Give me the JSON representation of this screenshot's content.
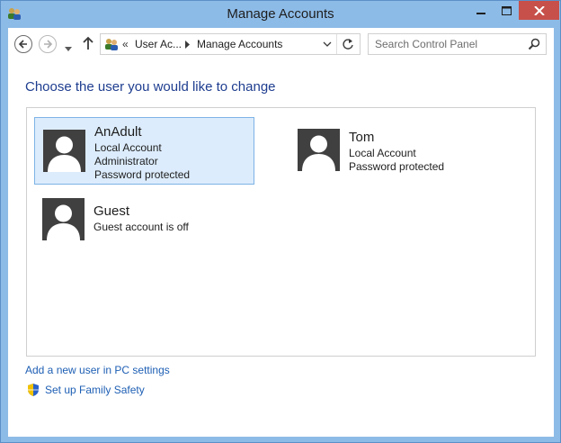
{
  "window": {
    "title": "Manage Accounts"
  },
  "nav": {
    "breadcrumb_overflow": "«",
    "breadcrumb_parent": "User Ac...",
    "breadcrumb_current": "Manage Accounts",
    "search_placeholder": "Search Control Panel"
  },
  "content": {
    "heading": "Choose the user you would like to change",
    "accounts": [
      {
        "name": "AnAdult",
        "lines": [
          "Local Account",
          "Administrator",
          "Password protected"
        ],
        "selected": true
      },
      {
        "name": "Tom",
        "lines": [
          "Local Account",
          "Password protected"
        ],
        "selected": false
      },
      {
        "name": "Guest",
        "lines": [
          "Guest account is off"
        ],
        "selected": false
      }
    ],
    "links": {
      "add_user": "Add a new user in PC settings",
      "family_safety": "Set up Family Safety"
    }
  },
  "colors": {
    "titlebar": "#8dbbe7",
    "close_button": "#c7504a",
    "link": "#1e5fb4",
    "heading": "#1e3d8f",
    "selection": "#dcecfc"
  },
  "icons": [
    "control-panel-icon",
    "back-arrow-icon",
    "forward-arrow-icon",
    "up-arrow-icon",
    "refresh-icon",
    "search-icon",
    "user-avatar-icon",
    "shield-icon"
  ]
}
